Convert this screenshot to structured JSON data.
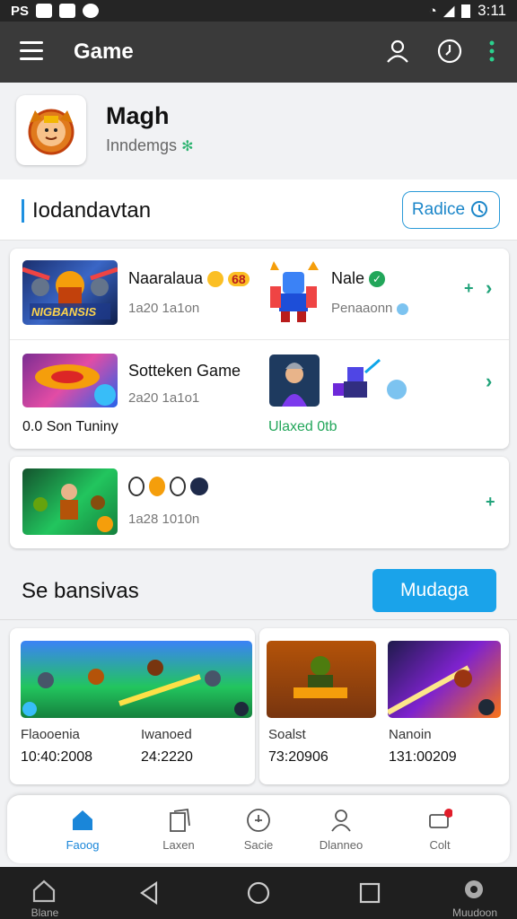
{
  "status_bar": {
    "left_text": "PS",
    "time": "3:11"
  },
  "app_bar": {
    "title": "Game"
  },
  "profile": {
    "name": "Magh",
    "subtitle": "Inndemgs"
  },
  "section1": {
    "title": "Iodandavtan",
    "button_label": "Radice"
  },
  "games": [
    {
      "title": "Naaralaua",
      "meta": "1a20 1a1on",
      "thumb_text": "NIGBANSIS",
      "badge_text": "68"
    },
    {
      "title": "Nale",
      "meta": "Penaaonn"
    },
    {
      "title": "Sotteken Game",
      "meta": "2a20 1a1o1",
      "footer": "0.0 Son Tuniny"
    },
    {
      "title": "",
      "meta": "",
      "footer": "Ulaxed 0tb"
    },
    {
      "title": "",
      "meta": "1a28 1010n"
    }
  ],
  "section2": {
    "title": "Se bansivas",
    "button_label": "Mudaga"
  },
  "browse": [
    {
      "name": "Flaooenia",
      "value": "10:40:2008"
    },
    {
      "name": "Iwanoed",
      "value": "24:2220"
    },
    {
      "name": "Soalst",
      "value": "73:20906"
    },
    {
      "name": "Nanoin",
      "value": "131:00209"
    }
  ],
  "bottom_nav": [
    {
      "label": "Faoog"
    },
    {
      "label": "Laxen"
    },
    {
      "label": "Sacie"
    },
    {
      "label": "Dlanneo"
    },
    {
      "label": "Colt"
    }
  ],
  "system_nav": {
    "left_label": "Blane",
    "right_label": "Muudoon"
  },
  "colors": {
    "accent": "#1aa3ea",
    "green": "#21a37a",
    "appbar": "#3a3a3a"
  }
}
